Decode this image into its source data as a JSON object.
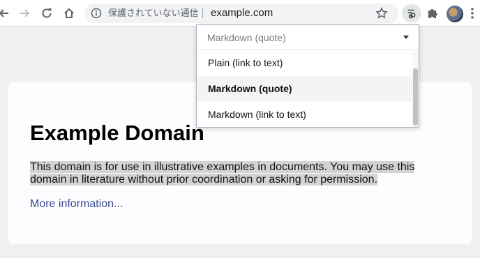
{
  "browser": {
    "security_label": "保護されていない通信",
    "url": "example.com",
    "colors": {
      "toolbar": "#ffffff",
      "omnibox": "#f1f3f4",
      "icon": "#5f6368"
    }
  },
  "page": {
    "title": "Example Domain",
    "body_text": "This domain is for use in illustrative examples in documents. You may use this domain in literature without prior coordination or asking for permission.",
    "link_text": "More information...",
    "colors": {
      "background": "#f0f0f2",
      "card": "#fdfdff",
      "link": "#38488f",
      "highlight": "#d3d3d3"
    }
  },
  "format_dropdown": {
    "selected_value": "Markdown (quote)",
    "options": [
      {
        "label": "Plain (link to text)",
        "selected": false
      },
      {
        "label": "Markdown (quote)",
        "selected": true
      },
      {
        "label": "Markdown (link to text)",
        "selected": false
      }
    ]
  }
}
